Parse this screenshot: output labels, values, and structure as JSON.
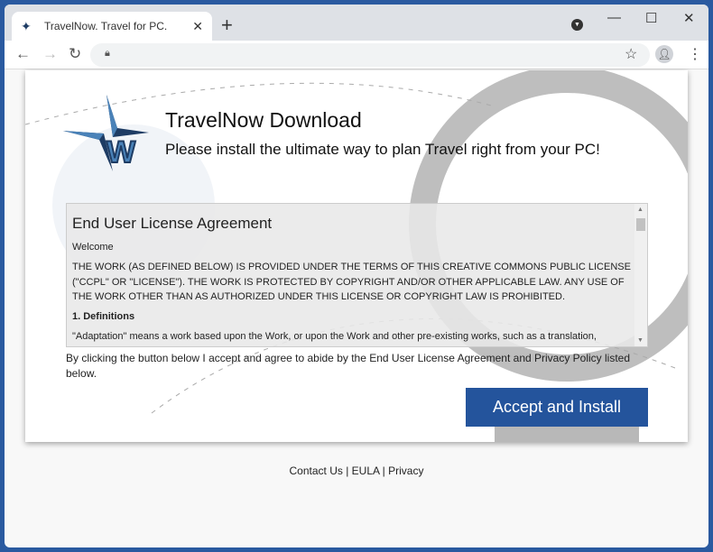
{
  "browser": {
    "tab_title": "TravelNow. Travel for PC.",
    "tab_close": "✕",
    "new_tab": "+",
    "minimize": "—",
    "maximize": "☐",
    "close": "✕"
  },
  "page": {
    "title": "TravelNow Download",
    "subtitle": "Please install the ultimate way to plan Travel right from your PC!",
    "eula": {
      "heading": "End User License Agreement",
      "welcome": "Welcome",
      "body": "THE WORK (AS DEFINED BELOW) IS PROVIDED UNDER THE TERMS OF THIS CREATIVE COMMONS PUBLIC LICENSE (\"CCPL\" OR \"LICENSE\"). THE WORK IS PROTECTED BY COPYRIGHT AND/OR OTHER APPLICABLE LAW. ANY USE OF THE WORK OTHER THAN AS AUTHORIZED UNDER THIS LICENSE OR COPYRIGHT LAW IS PROHIBITED.",
      "section": "1. Definitions",
      "adaptation": "\"Adaptation\" means a work based upon the Work, or upon the Work and other pre-existing works, such as a translation,"
    },
    "agree_text": "By clicking the button below I accept and agree to abide by the End User License Agreement and Privacy Policy listed below.",
    "button": "Accept and Install",
    "logo_letter": "W"
  },
  "footer": {
    "contact": "Contact Us",
    "sep": " | ",
    "eula": "EULA",
    "privacy": "Privacy"
  },
  "colors": {
    "accent": "#24549c",
    "frame": "#2a5aa0"
  }
}
